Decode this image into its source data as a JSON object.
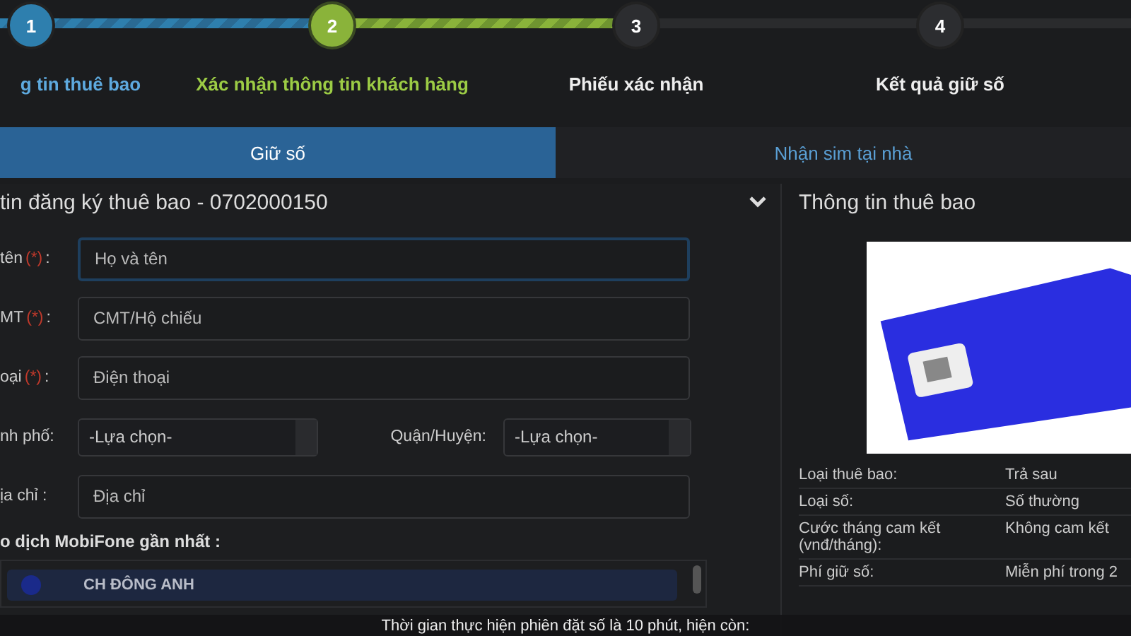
{
  "steps": [
    {
      "number": "1",
      "label": "g tin thuê bao",
      "done": true,
      "current": false
    },
    {
      "number": "2",
      "label": "Xác nhận thông tin khách hàng",
      "done": false,
      "current": true
    },
    {
      "number": "3",
      "label": "Phiếu xác nhận",
      "done": false,
      "current": false
    },
    {
      "number": "4",
      "label": "Kết quả giữ số",
      "done": false,
      "current": false
    }
  ],
  "tabs": [
    {
      "label": "Giữ số",
      "selected": true
    },
    {
      "label": "Nhận sim tại nhà",
      "selected": false
    }
  ],
  "form": {
    "title": "tin đăng ký thuê bao - 0702000150",
    "fields": [
      {
        "kind": "text",
        "label": "tên",
        "required": true,
        "required_mark": "(*)",
        "suffix": ":",
        "placeholder": "Họ và tên",
        "focused": true
      },
      {
        "kind": "text",
        "label": "MT",
        "required": true,
        "required_mark": "(*)",
        "suffix": ":",
        "placeholder": "CMT/Hộ chiếu",
        "focused": false
      },
      {
        "kind": "text",
        "label": "oại",
        "required": true,
        "required_mark": "(*)",
        "suffix": ":",
        "placeholder": "Điện thoại",
        "focused": false
      },
      {
        "kind": "select_pair",
        "items": [
          {
            "label": "nh phố:",
            "value": "-Lựa chọn-"
          },
          {
            "label": "Quận/Huyện:",
            "value": "-Lựa chọn-"
          }
        ]
      },
      {
        "kind": "text",
        "label": "ịa chỉ :",
        "required": false,
        "placeholder": "Địa chỉ",
        "focused": false
      }
    ]
  },
  "stores": {
    "heading": "o dịch MobiFone gần nhất :",
    "items": [
      {
        "name": "CH ĐÔNG ANH"
      }
    ]
  },
  "info": {
    "title": "Thông tin thuê bao",
    "rows": [
      {
        "label": "Loại thuê bao:",
        "value": "Trả sau"
      },
      {
        "label": "Loại số:",
        "value": "Số thường"
      },
      {
        "label": "Cước tháng cam kết (vnđ/tháng):",
        "value": "Không cam kết"
      },
      {
        "label": "Phí giữ số:",
        "value": "Miễn phí trong 2"
      }
    ]
  },
  "notice": {
    "text": "Thời gian thực hiện phiên đặt số là 10 phút, hiện còn:"
  }
}
